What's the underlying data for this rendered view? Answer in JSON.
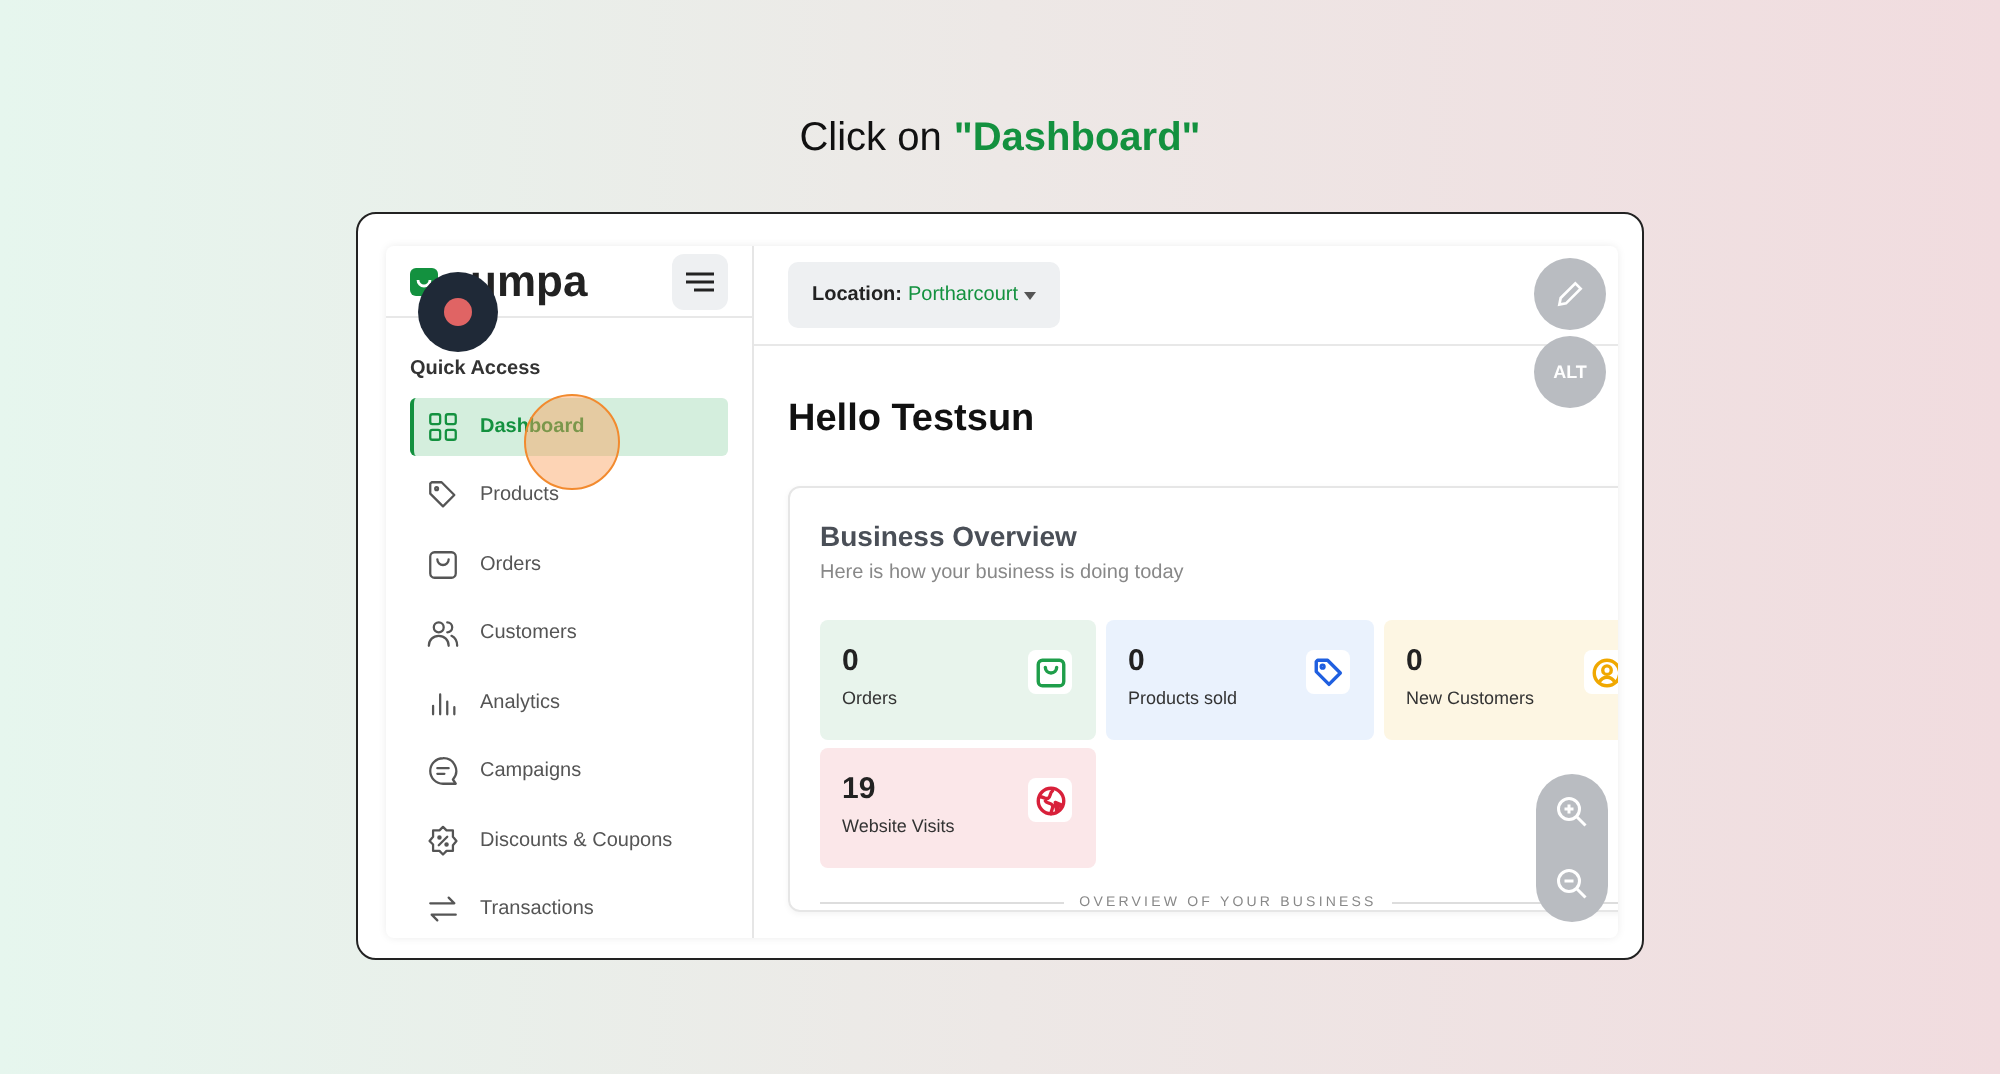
{
  "instruction": {
    "text": "Click on",
    "target": "\"Dashboard\""
  },
  "logo": {
    "text": "umpa"
  },
  "sidebar": {
    "section": "Quick Access",
    "items": [
      {
        "label": "Dashboard",
        "kind": "grid",
        "selected": true
      },
      {
        "label": "Products",
        "kind": "tag",
        "selected": false
      },
      {
        "label": "Orders",
        "kind": "bag",
        "selected": false
      },
      {
        "label": "Customers",
        "kind": "users",
        "selected": false
      },
      {
        "label": "Analytics",
        "kind": "bars",
        "selected": false
      },
      {
        "label": "Campaigns",
        "kind": "chat",
        "selected": false
      },
      {
        "label": "Discounts & Coupons",
        "kind": "discount",
        "selected": false
      },
      {
        "label": "Transactions",
        "kind": "swap",
        "selected": false
      }
    ]
  },
  "header": {
    "location_label": "Location:",
    "location_value": "Portharcourt"
  },
  "floating": {
    "alt": "ALT"
  },
  "greeting": "Hello Testsun",
  "overview": {
    "title": "Business Overview",
    "subtitle": "Here is how your business is doing today",
    "stats": [
      {
        "value": "0",
        "label": "Orders",
        "kind": "bag",
        "color": "#1e9e4a"
      },
      {
        "value": "0",
        "label": "Products sold",
        "kind": "tag",
        "color": "#1f5fe0"
      },
      {
        "value": "0",
        "label": "New Customers",
        "kind": "user",
        "color": "#f0a800"
      },
      {
        "value": "19",
        "label": "Website Visits",
        "kind": "globe",
        "color": "#d8203a"
      }
    ],
    "divider": "OVERVIEW OF YOUR BUSINESS"
  }
}
